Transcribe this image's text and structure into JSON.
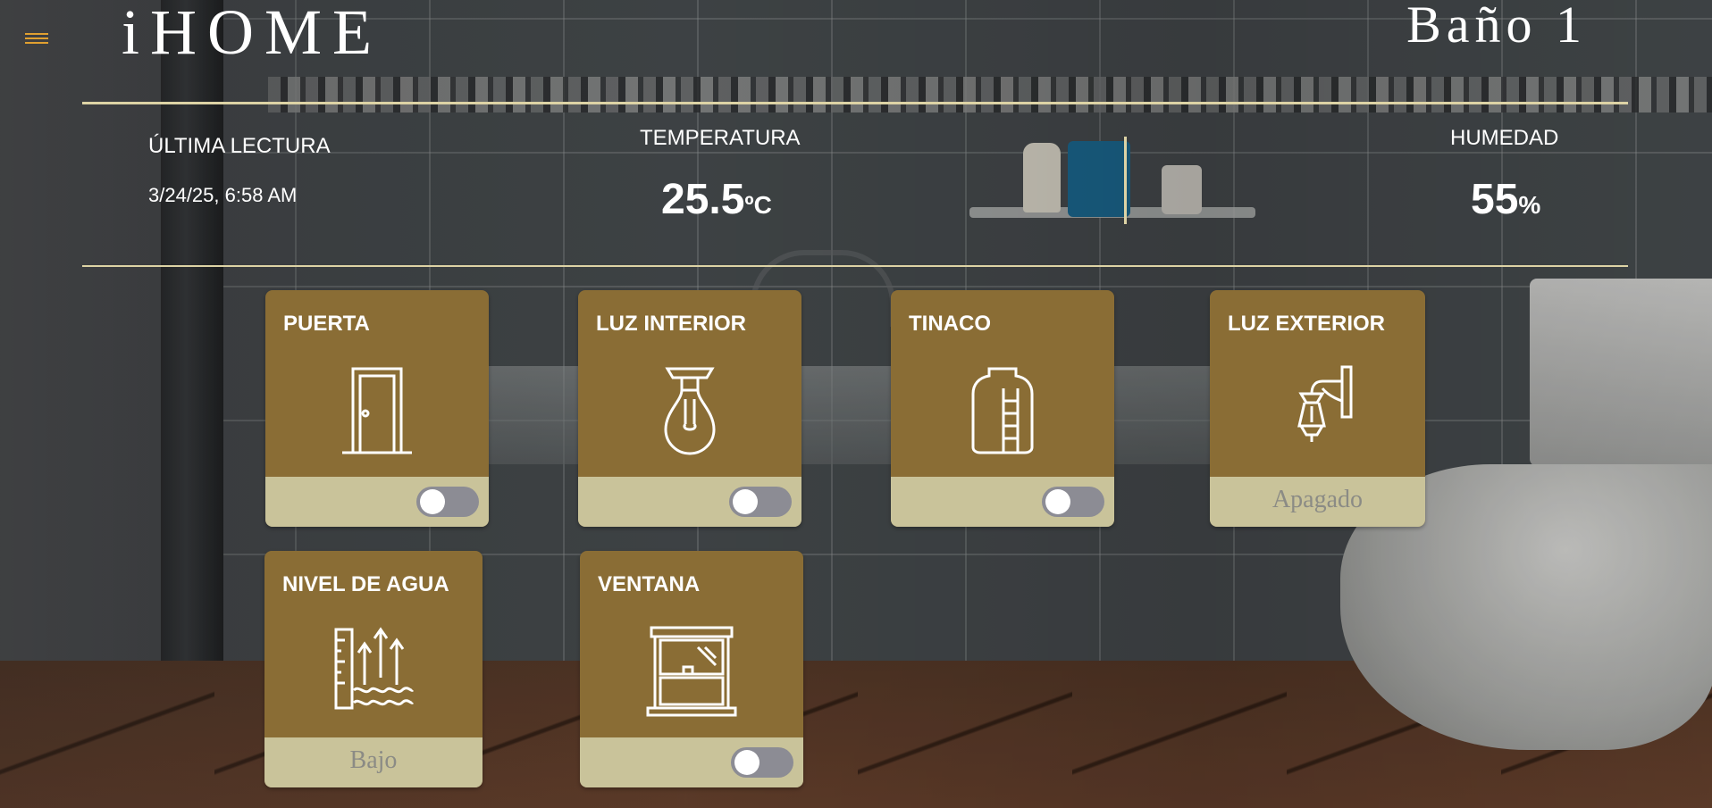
{
  "header": {
    "menu_icon": "hamburger-menu-icon",
    "app_title": "iHOME",
    "room_title": "Baño 1"
  },
  "stats": {
    "last_reading_label": "ÚLTIMA LECTURA",
    "last_reading_value": "3/24/25, 6:58 AM",
    "temperature_label": "TEMPERATURA",
    "temperature_value": "25.5",
    "temperature_unit": "ºC",
    "humidity_label": "HUMEDAD",
    "humidity_value": "55",
    "humidity_unit": "%"
  },
  "cards": [
    {
      "title": "PUERTA",
      "icon": "door-icon",
      "control": "toggle",
      "on": false
    },
    {
      "title": "LUZ INTERIOR",
      "icon": "light-bulb-icon",
      "control": "toggle",
      "on": false
    },
    {
      "title": "TINACO",
      "icon": "water-tank-icon",
      "control": "toggle",
      "on": false
    },
    {
      "title": "LUZ EXTERIOR",
      "icon": "wall-lantern-icon",
      "control": "status",
      "status": "Apagado"
    },
    {
      "title": "NIVEL DE AGUA",
      "icon": "water-level-icon",
      "control": "status",
      "status": "Bajo"
    },
    {
      "title": "VENTANA",
      "icon": "window-icon",
      "control": "toggle",
      "on": false
    }
  ],
  "colors": {
    "card_bg": "#8a6d35",
    "card_footer": "#c9c39a",
    "rule": "#ddd3a5",
    "menu_accent": "#e0a030",
    "toggle_off": "#8c8c94"
  }
}
